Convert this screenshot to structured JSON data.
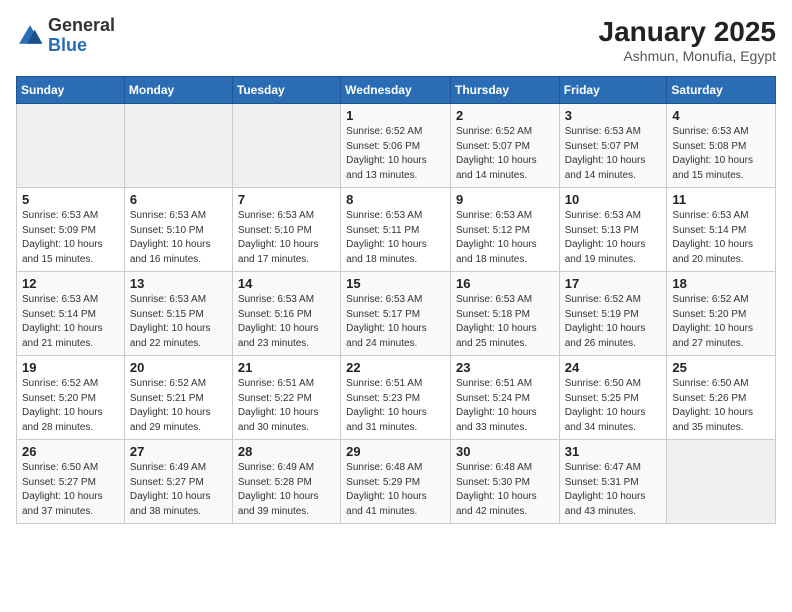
{
  "header": {
    "logo_general": "General",
    "logo_blue": "Blue",
    "title": "January 2025",
    "subtitle": "Ashmun, Monufia, Egypt"
  },
  "weekdays": [
    "Sunday",
    "Monday",
    "Tuesday",
    "Wednesday",
    "Thursday",
    "Friday",
    "Saturday"
  ],
  "weeks": [
    [
      {
        "day": "",
        "info": ""
      },
      {
        "day": "",
        "info": ""
      },
      {
        "day": "",
        "info": ""
      },
      {
        "day": "1",
        "info": "Sunrise: 6:52 AM\nSunset: 5:06 PM\nDaylight: 10 hours\nand 13 minutes."
      },
      {
        "day": "2",
        "info": "Sunrise: 6:52 AM\nSunset: 5:07 PM\nDaylight: 10 hours\nand 14 minutes."
      },
      {
        "day": "3",
        "info": "Sunrise: 6:53 AM\nSunset: 5:07 PM\nDaylight: 10 hours\nand 14 minutes."
      },
      {
        "day": "4",
        "info": "Sunrise: 6:53 AM\nSunset: 5:08 PM\nDaylight: 10 hours\nand 15 minutes."
      }
    ],
    [
      {
        "day": "5",
        "info": "Sunrise: 6:53 AM\nSunset: 5:09 PM\nDaylight: 10 hours\nand 15 minutes."
      },
      {
        "day": "6",
        "info": "Sunrise: 6:53 AM\nSunset: 5:10 PM\nDaylight: 10 hours\nand 16 minutes."
      },
      {
        "day": "7",
        "info": "Sunrise: 6:53 AM\nSunset: 5:10 PM\nDaylight: 10 hours\nand 17 minutes."
      },
      {
        "day": "8",
        "info": "Sunrise: 6:53 AM\nSunset: 5:11 PM\nDaylight: 10 hours\nand 18 minutes."
      },
      {
        "day": "9",
        "info": "Sunrise: 6:53 AM\nSunset: 5:12 PM\nDaylight: 10 hours\nand 18 minutes."
      },
      {
        "day": "10",
        "info": "Sunrise: 6:53 AM\nSunset: 5:13 PM\nDaylight: 10 hours\nand 19 minutes."
      },
      {
        "day": "11",
        "info": "Sunrise: 6:53 AM\nSunset: 5:14 PM\nDaylight: 10 hours\nand 20 minutes."
      }
    ],
    [
      {
        "day": "12",
        "info": "Sunrise: 6:53 AM\nSunset: 5:14 PM\nDaylight: 10 hours\nand 21 minutes."
      },
      {
        "day": "13",
        "info": "Sunrise: 6:53 AM\nSunset: 5:15 PM\nDaylight: 10 hours\nand 22 minutes."
      },
      {
        "day": "14",
        "info": "Sunrise: 6:53 AM\nSunset: 5:16 PM\nDaylight: 10 hours\nand 23 minutes."
      },
      {
        "day": "15",
        "info": "Sunrise: 6:53 AM\nSunset: 5:17 PM\nDaylight: 10 hours\nand 24 minutes."
      },
      {
        "day": "16",
        "info": "Sunrise: 6:53 AM\nSunset: 5:18 PM\nDaylight: 10 hours\nand 25 minutes."
      },
      {
        "day": "17",
        "info": "Sunrise: 6:52 AM\nSunset: 5:19 PM\nDaylight: 10 hours\nand 26 minutes."
      },
      {
        "day": "18",
        "info": "Sunrise: 6:52 AM\nSunset: 5:20 PM\nDaylight: 10 hours\nand 27 minutes."
      }
    ],
    [
      {
        "day": "19",
        "info": "Sunrise: 6:52 AM\nSunset: 5:20 PM\nDaylight: 10 hours\nand 28 minutes."
      },
      {
        "day": "20",
        "info": "Sunrise: 6:52 AM\nSunset: 5:21 PM\nDaylight: 10 hours\nand 29 minutes."
      },
      {
        "day": "21",
        "info": "Sunrise: 6:51 AM\nSunset: 5:22 PM\nDaylight: 10 hours\nand 30 minutes."
      },
      {
        "day": "22",
        "info": "Sunrise: 6:51 AM\nSunset: 5:23 PM\nDaylight: 10 hours\nand 31 minutes."
      },
      {
        "day": "23",
        "info": "Sunrise: 6:51 AM\nSunset: 5:24 PM\nDaylight: 10 hours\nand 33 minutes."
      },
      {
        "day": "24",
        "info": "Sunrise: 6:50 AM\nSunset: 5:25 PM\nDaylight: 10 hours\nand 34 minutes."
      },
      {
        "day": "25",
        "info": "Sunrise: 6:50 AM\nSunset: 5:26 PM\nDaylight: 10 hours\nand 35 minutes."
      }
    ],
    [
      {
        "day": "26",
        "info": "Sunrise: 6:50 AM\nSunset: 5:27 PM\nDaylight: 10 hours\nand 37 minutes."
      },
      {
        "day": "27",
        "info": "Sunrise: 6:49 AM\nSunset: 5:27 PM\nDaylight: 10 hours\nand 38 minutes."
      },
      {
        "day": "28",
        "info": "Sunrise: 6:49 AM\nSunset: 5:28 PM\nDaylight: 10 hours\nand 39 minutes."
      },
      {
        "day": "29",
        "info": "Sunrise: 6:48 AM\nSunset: 5:29 PM\nDaylight: 10 hours\nand 41 minutes."
      },
      {
        "day": "30",
        "info": "Sunrise: 6:48 AM\nSunset: 5:30 PM\nDaylight: 10 hours\nand 42 minutes."
      },
      {
        "day": "31",
        "info": "Sunrise: 6:47 AM\nSunset: 5:31 PM\nDaylight: 10 hours\nand 43 minutes."
      },
      {
        "day": "",
        "info": ""
      }
    ]
  ]
}
